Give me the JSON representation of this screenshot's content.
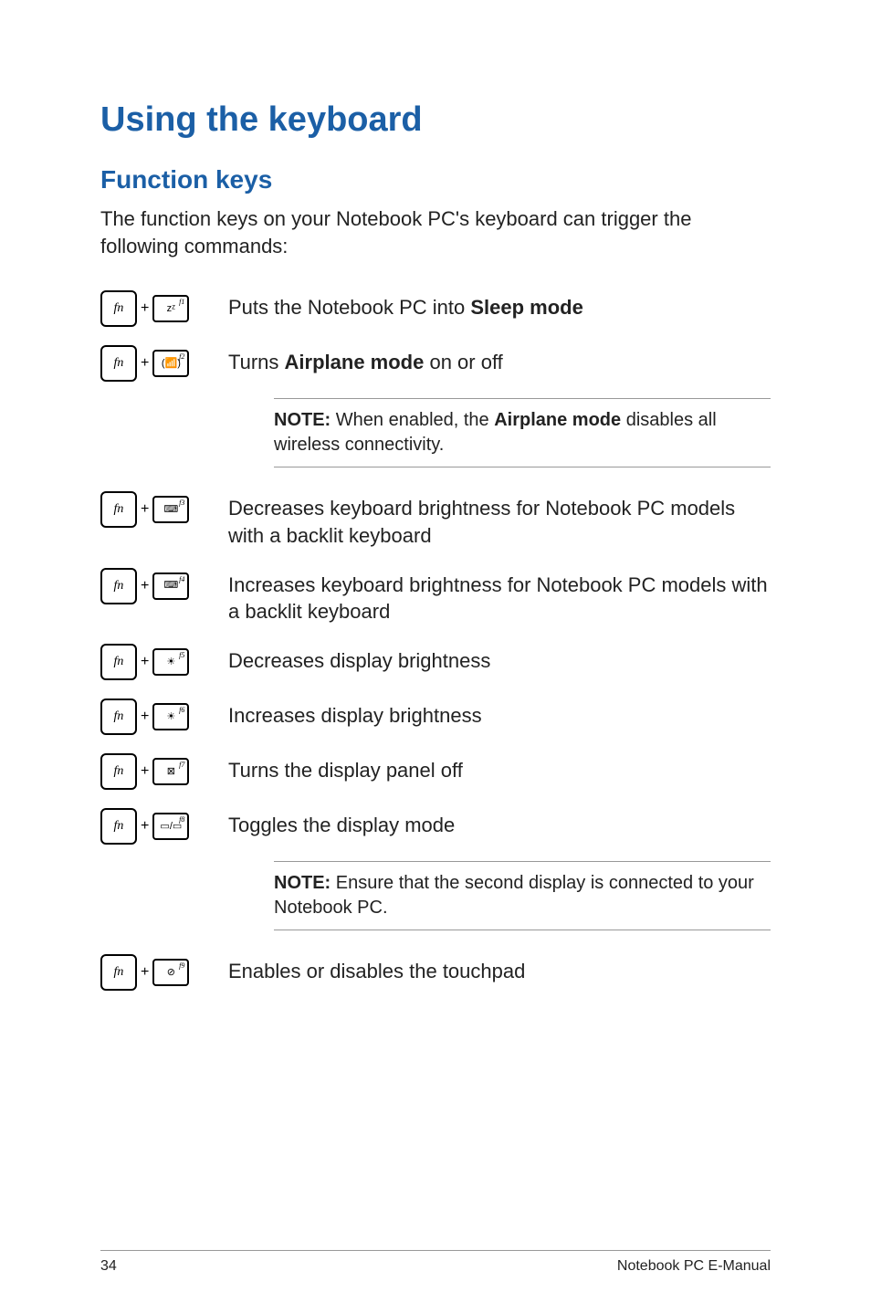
{
  "heading1": "Using the keyboard",
  "heading2": "Function keys",
  "intro": "The function keys on your Notebook PC's keyboard can trigger the following commands:",
  "keys": {
    "fn": "fn",
    "plus": "+",
    "f1": {
      "sup": "f1",
      "icon": "zᶻ"
    },
    "f2": {
      "sup": "f2",
      "icon": "(📶)"
    },
    "f3": {
      "sup": "f3",
      "icon": "⌨"
    },
    "f4": {
      "sup": "f4",
      "icon": "⌨"
    },
    "f5": {
      "sup": "f5",
      "icon": "☀"
    },
    "f6": {
      "sup": "f6",
      "icon": "☀"
    },
    "f7": {
      "sup": "f7",
      "icon": "⊠"
    },
    "f8": {
      "sup": "f8",
      "icon": "▭/▭"
    },
    "f9": {
      "sup": "f9",
      "icon": "⊘"
    }
  },
  "descs": {
    "f1_pre": "Puts the Notebook PC into ",
    "f1_bold": "Sleep mode",
    "f2_pre": "Turns ",
    "f2_bold": "Airplane mode",
    "f2_post": " on or off",
    "f3": "Decreases keyboard brightness for Notebook PC models with a backlit keyboard",
    "f4": "Increases keyboard brightness for Notebook PC models with a backlit keyboard",
    "f5": "Decreases display brightness",
    "f6": "Increases display brightness",
    "f7": "Turns the display panel off",
    "f8": "Toggles the display mode",
    "f9": "Enables or disables the touchpad"
  },
  "notes": {
    "note1_bold1": "NOTE:",
    "note1_mid": " When enabled, the ",
    "note1_bold2": "Airplane mode",
    "note1_post": " disables all wireless connectivity.",
    "note2_bold": "NOTE:",
    "note2_post": " Ensure that the second display is connected to your Notebook PC."
  },
  "footer": {
    "page": "34",
    "title": "Notebook PC E-Manual"
  }
}
